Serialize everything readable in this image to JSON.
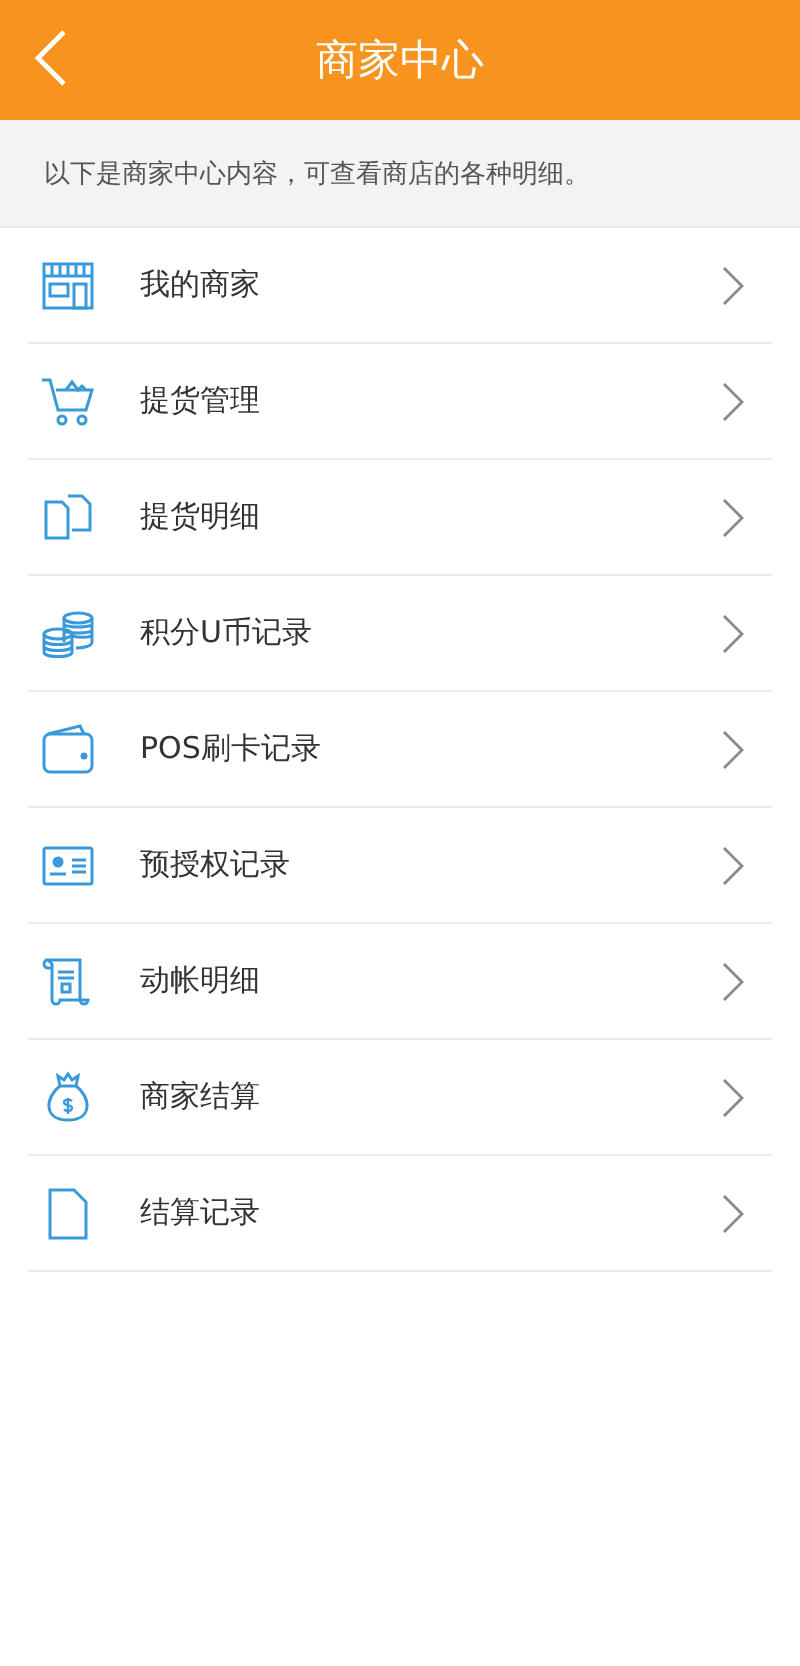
{
  "header": {
    "title": "商家中心"
  },
  "intro": "以下是商家中心内容，可查看商店的各种明细。",
  "items": [
    {
      "label": "我的商家",
      "kind": "shop"
    },
    {
      "label": "提货管理",
      "kind": "cart"
    },
    {
      "label": "提货明细",
      "kind": "documents"
    },
    {
      "label": "积分U币记录",
      "kind": "coins"
    },
    {
      "label": "POS刷卡记录",
      "kind": "wallet"
    },
    {
      "label": "预授权记录",
      "kind": "idcard"
    },
    {
      "label": "动帐明细",
      "kind": "scroll"
    },
    {
      "label": "商家结算",
      "kind": "moneybag"
    },
    {
      "label": "结算记录",
      "kind": "document"
    }
  ]
}
